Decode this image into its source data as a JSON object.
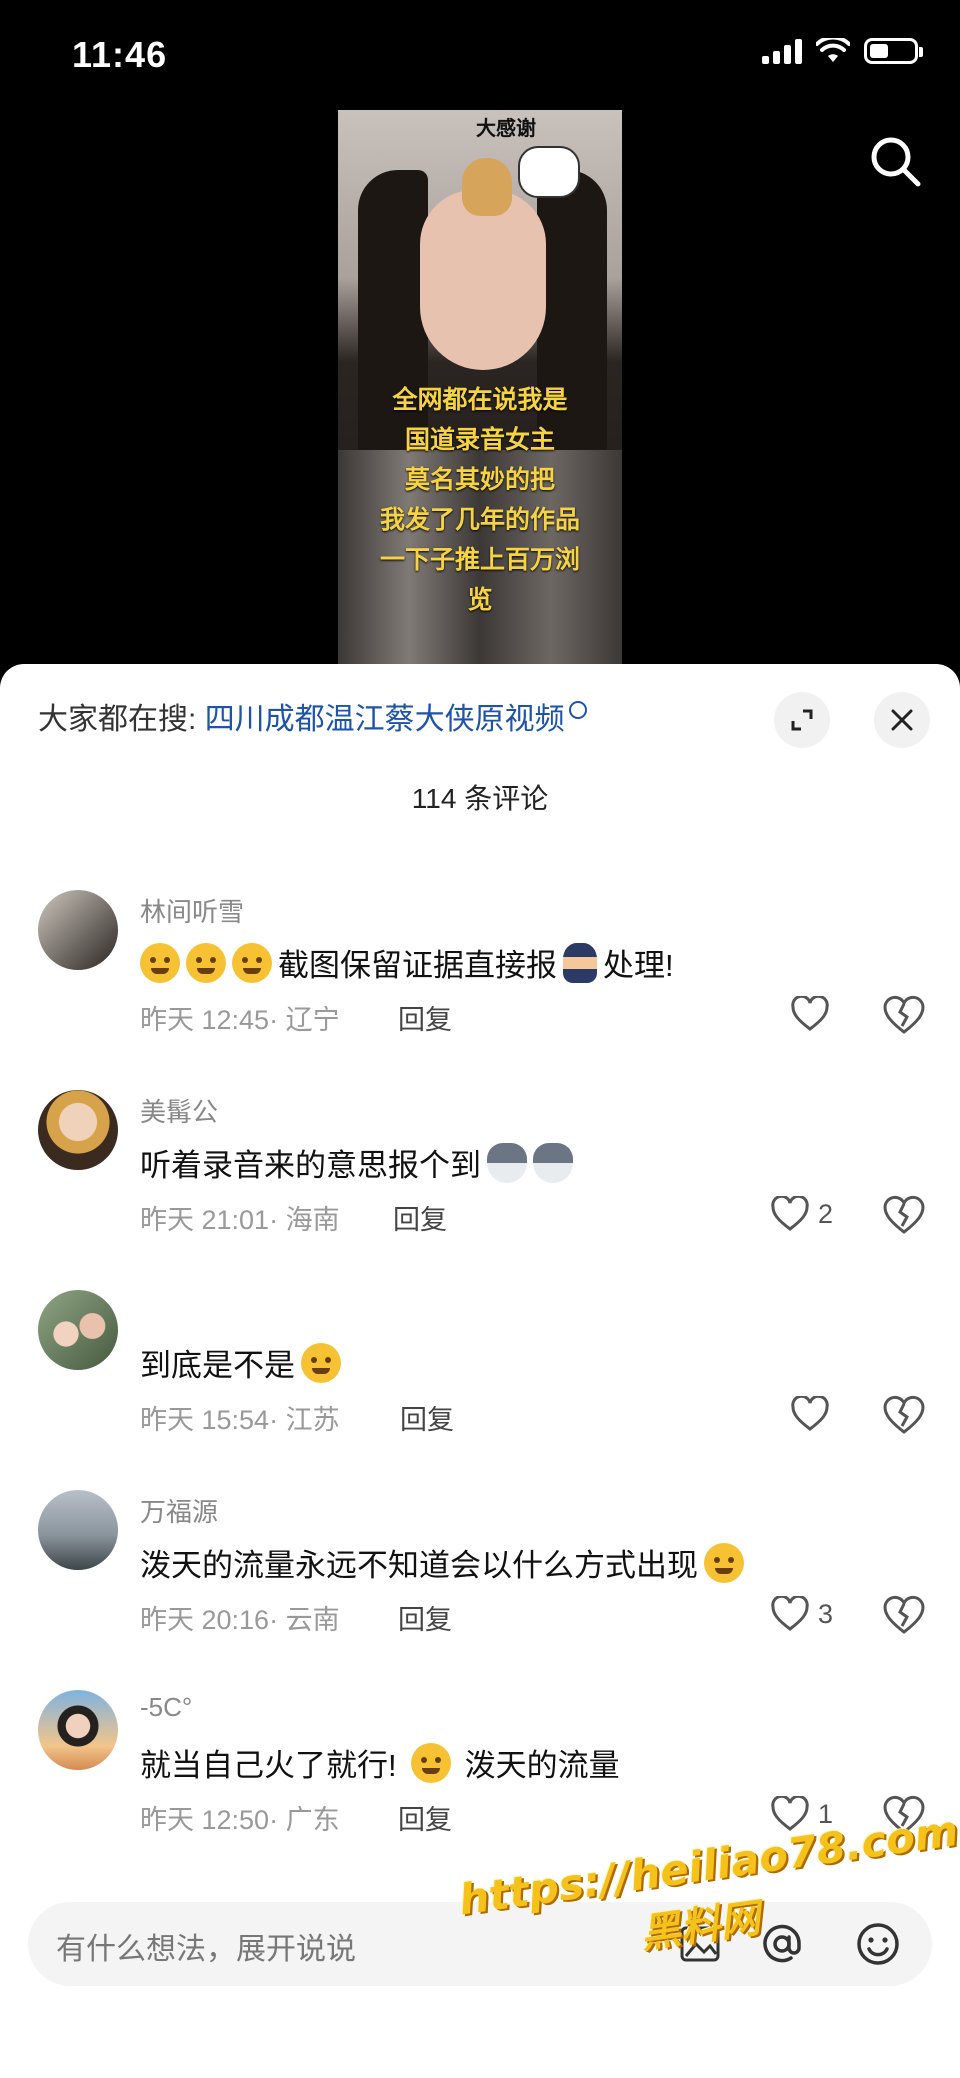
{
  "status_bar": {
    "time": "11:46"
  },
  "video": {
    "sticker_text": "大感谢",
    "caption_lines": [
      "全网都在说我是",
      "国道录音女主",
      "莫名其妙的把",
      "我发了几年的作品",
      "一下子推上百万浏",
      "览"
    ]
  },
  "sheet": {
    "search_prefix": "大家都在搜:",
    "search_query": "四川成都温江蔡大侠原视频",
    "comment_count": "114 条评论"
  },
  "comments": [
    {
      "username": "林间听雪",
      "text": "截图保留证据直接报",
      "text_after": "处理!",
      "time": "昨天 12:45",
      "region": "· 辽宁",
      "reply": "回复",
      "likes": ""
    },
    {
      "username": "美髯公",
      "text": "听着录音来的意思报个到",
      "text_after": "",
      "time": "昨天 21:01",
      "region": "· 海南",
      "reply": "回复",
      "likes": "2"
    },
    {
      "username": "",
      "text": "到底是不是",
      "text_after": "",
      "time": "昨天 15:54",
      "region": "· 江苏",
      "reply": "回复",
      "likes": ""
    },
    {
      "username": "万福源",
      "text": "泼天的流量永远不知道会以什么方式出现",
      "text_after": "",
      "time": "昨天 20:16",
      "region": "· 云南",
      "reply": "回复",
      "likes": "3"
    },
    {
      "username": "-5C°",
      "text": "就当自己火了就行!",
      "text_after": "泼天的流量",
      "time": "昨天 12:50",
      "region": "· 广东",
      "reply": "回复",
      "likes": "1"
    }
  ],
  "input": {
    "placeholder": "有什么想法，展开说说"
  },
  "watermark": {
    "url": "https://heiliao78.com",
    "name": "黑料网"
  },
  "colors": {
    "link": "#1e54a8",
    "caption": "#f5d342",
    "watermark": "#f4c21a"
  }
}
